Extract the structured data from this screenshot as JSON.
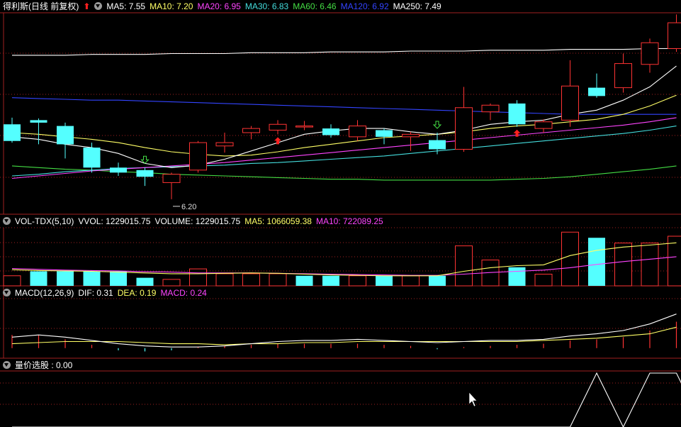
{
  "header_main": {
    "name": "得利斯(日线 前复权)",
    "ma": [
      {
        "label": "MA5: 7.55",
        "color": "#ffffff"
      },
      {
        "label": "MA10: 7.20",
        "color": "#ffff66"
      },
      {
        "label": "MA20: 6.95",
        "color": "#ff44ff"
      },
      {
        "label": "MA30: 6.83",
        "color": "#44dddd"
      },
      {
        "label": "MA60: 6.46",
        "color": "#44dd44"
      },
      {
        "label": "MA120: 6.92",
        "color": "#3344ff"
      },
      {
        "label": "MA250: 7.49",
        "color": "#ffffff"
      }
    ]
  },
  "header_vol": {
    "name": "VOL-TDX(5,10)",
    "items": [
      {
        "label": "VVOL: 1229015.75",
        "color": "#ffffff"
      },
      {
        "label": "VOLUME: 1229015.75",
        "color": "#ffffff"
      },
      {
        "label": "MA5: 1066059.38",
        "color": "#ffff66"
      },
      {
        "label": "MA10: 722089.25",
        "color": "#ff44ff"
      }
    ]
  },
  "header_macd": {
    "name": "MACD(12,26,9)",
    "items": [
      {
        "label": "DIF: 0.31",
        "color": "#ffffff"
      },
      {
        "label": "DEA: 0.19",
        "color": "#ffff66"
      },
      {
        "label": "MACD: 0.24",
        "color": "#ff44ff"
      }
    ]
  },
  "header_xg": {
    "name": "量价选股 : 0.00"
  },
  "colors": {
    "up": "#ff3333",
    "down": "#54ffff",
    "frame": "#a02020",
    "grid": "#a02020",
    "ma5": "#ffffff",
    "ma10": "#ffff66",
    "ma20": "#ff44ff",
    "ma30": "#44dddd",
    "ma60": "#44dd44",
    "ma120": "#3344ff",
    "ma250": "#ffffff"
  },
  "chart_data": {
    "type": "candlestick",
    "price_range": [
      6.02,
      8.44
    ],
    "low_annotation": {
      "text": "6.20",
      "index": 6
    },
    "candles": [
      {
        "o": 7.1,
        "h": 7.18,
        "l": 6.88,
        "c": 6.9
      },
      {
        "o": 7.15,
        "h": 7.17,
        "l": 6.86,
        "c": 7.12
      },
      {
        "o": 7.08,
        "h": 7.12,
        "l": 6.69,
        "c": 6.86
      },
      {
        "o": 6.82,
        "h": 6.88,
        "l": 6.52,
        "c": 6.58
      },
      {
        "o": 6.58,
        "h": 6.64,
        "l": 6.48,
        "c": 6.52
      },
      {
        "o": 6.55,
        "h": 6.58,
        "l": 6.36,
        "c": 6.47
      },
      {
        "o": 6.4,
        "h": 6.52,
        "l": 6.2,
        "c": 6.5
      },
      {
        "o": 6.55,
        "h": 6.9,
        "l": 6.52,
        "c": 6.88
      },
      {
        "o": 6.84,
        "h": 7.0,
        "l": 6.76,
        "c": 6.88
      },
      {
        "o": 7.0,
        "h": 7.08,
        "l": 6.92,
        "c": 7.05
      },
      {
        "o": 7.03,
        "h": 7.15,
        "l": 6.98,
        "c": 7.1
      },
      {
        "o": 7.08,
        "h": 7.14,
        "l": 7.03,
        "c": 7.08
      },
      {
        "o": 7.05,
        "h": 7.1,
        "l": 6.94,
        "c": 6.97
      },
      {
        "o": 6.95,
        "h": 7.15,
        "l": 6.9,
        "c": 7.08
      },
      {
        "o": 7.03,
        "h": 7.05,
        "l": 6.86,
        "c": 6.95
      },
      {
        "o": 6.95,
        "h": 7.01,
        "l": 6.78,
        "c": 6.98
      },
      {
        "o": 6.91,
        "h": 7.0,
        "l": 6.74,
        "c": 6.8
      },
      {
        "o": 6.8,
        "h": 7.55,
        "l": 6.77,
        "c": 7.3
      },
      {
        "o": 7.25,
        "h": 7.35,
        "l": 7.15,
        "c": 7.33
      },
      {
        "o": 7.35,
        "h": 7.39,
        "l": 7.07,
        "c": 7.1
      },
      {
        "o": 7.05,
        "h": 7.16,
        "l": 7.0,
        "c": 7.13
      },
      {
        "o": 7.15,
        "h": 7.87,
        "l": 7.07,
        "c": 7.56
      },
      {
        "o": 7.54,
        "h": 7.71,
        "l": 7.42,
        "c": 7.44
      },
      {
        "o": 7.54,
        "h": 7.95,
        "l": 7.48,
        "c": 7.83
      },
      {
        "o": 7.82,
        "h": 8.13,
        "l": 7.72,
        "c": 8.08
      },
      {
        "o": 8.01,
        "h": 8.42,
        "l": 7.97,
        "c": 8.32
      }
    ],
    "signals_up": [
      10,
      19
    ],
    "signals_hollow_down": [
      5,
      16
    ],
    "ma5": [
      6.95,
      6.92,
      6.86,
      6.82,
      6.75,
      6.63,
      6.58,
      6.61,
      6.68,
      6.78,
      6.88,
      6.98,
      7.02,
      7.05,
      7.05,
      7.01,
      6.98,
      7.03,
      7.1,
      7.13,
      7.15,
      7.22,
      7.27,
      7.39,
      7.55,
      7.8
    ],
    "ma10": [
      7.0,
      6.98,
      6.95,
      6.92,
      6.88,
      6.82,
      6.77,
      6.74,
      6.72,
      6.73,
      6.77,
      6.82,
      6.86,
      6.9,
      6.94,
      6.96,
      6.98,
      7.01,
      7.05,
      7.08,
      7.1,
      7.13,
      7.16,
      7.22,
      7.32,
      7.45
    ],
    "ma20": [
      6.45,
      6.48,
      6.51,
      6.54,
      6.56,
      6.58,
      6.6,
      6.62,
      6.64,
      6.67,
      6.7,
      6.73,
      6.76,
      6.79,
      6.82,
      6.85,
      6.88,
      6.91,
      6.94,
      6.97,
      7.0,
      7.03,
      7.06,
      7.09,
      7.13,
      7.18
    ],
    "ma30": [
      6.48,
      6.5,
      6.53,
      6.55,
      6.57,
      6.58,
      6.59,
      6.6,
      6.61,
      6.63,
      6.64,
      6.66,
      6.68,
      6.7,
      6.72,
      6.75,
      6.78,
      6.81,
      6.84,
      6.87,
      6.9,
      6.93,
      6.96,
      6.99,
      7.03,
      7.08
    ],
    "ma60": [
      6.6,
      6.58,
      6.56,
      6.55,
      6.53,
      6.52,
      6.5,
      6.49,
      6.48,
      6.47,
      6.46,
      6.45,
      6.44,
      6.44,
      6.43,
      6.43,
      6.43,
      6.43,
      6.43,
      6.44,
      6.45,
      6.47,
      6.5,
      6.53,
      6.56,
      6.6
    ],
    "ma120": [
      7.42,
      7.41,
      7.4,
      7.39,
      7.39,
      7.38,
      7.37,
      7.36,
      7.35,
      7.34,
      7.33,
      7.32,
      7.31,
      7.3,
      7.29,
      7.28,
      7.27,
      7.26,
      7.25,
      7.24,
      7.23,
      7.22,
      7.22,
      7.22,
      7.22,
      7.22
    ],
    "ma250": [
      7.93,
      7.93,
      7.93,
      7.94,
      7.94,
      7.94,
      7.95,
      7.95,
      7.95,
      7.96,
      7.96,
      7.96,
      7.97,
      7.97,
      7.97,
      7.98,
      7.98,
      7.98,
      7.99,
      7.99,
      7.99,
      8.0,
      8.0,
      8.0,
      8.01,
      8.01
    ],
    "volume": {
      "range": [
        0,
        1440000
      ],
      "values": [
        250000,
        360000,
        360000,
        360000,
        360000,
        200000,
        160000,
        420000,
        300000,
        300000,
        300000,
        250000,
        250000,
        250000,
        250000,
        250000,
        250000,
        990000,
        640000,
        460000,
        290000,
        1330000,
        1190000,
        1060000,
        1060000,
        1229015.75
      ],
      "up": [
        true,
        false,
        false,
        false,
        false,
        false,
        true,
        true,
        true,
        true,
        true,
        false,
        false,
        true,
        false,
        true,
        false,
        true,
        true,
        false,
        true,
        true,
        false,
        true,
        true,
        true
      ],
      "ma5": [
        400000,
        380000,
        370000,
        360000,
        340000,
        320000,
        300000,
        300000,
        310000,
        320000,
        310000,
        290000,
        270000,
        260000,
        250000,
        250000,
        250000,
        360000,
        450000,
        500000,
        520000,
        750000,
        880000,
        960000,
        1010000,
        1066059.38
      ],
      "ma10": [
        430000,
        410000,
        390000,
        380000,
        370000,
        350000,
        340000,
        320000,
        320000,
        320000,
        310000,
        300000,
        290000,
        280000,
        270000,
        260000,
        260000,
        290000,
        330000,
        360000,
        390000,
        450000,
        530000,
        600000,
        660000,
        722089.25
      ]
    },
    "macd": {
      "range": [
        -0.04,
        0.45
      ],
      "dif": [
        0.1,
        0.12,
        0.1,
        0.07,
        0.04,
        0.02,
        0.01,
        0.01,
        0.02,
        0.04,
        0.06,
        0.07,
        0.07,
        0.08,
        0.07,
        0.06,
        0.05,
        0.06,
        0.07,
        0.07,
        0.08,
        0.11,
        0.13,
        0.16,
        0.22,
        0.31
      ],
      "dea": [
        0.04,
        0.05,
        0.06,
        0.06,
        0.06,
        0.05,
        0.04,
        0.04,
        0.03,
        0.04,
        0.04,
        0.05,
        0.05,
        0.06,
        0.06,
        0.06,
        0.06,
        0.06,
        0.06,
        0.06,
        0.07,
        0.08,
        0.09,
        0.11,
        0.13,
        0.19
      ],
      "bar": [
        0.12,
        0.12,
        0.08,
        0.03,
        -0.02,
        -0.03,
        -0.02,
        0.01,
        0.02,
        0.03,
        0.04,
        0.04,
        0.04,
        0.04,
        0.03,
        0.02,
        -0.01,
        0.01,
        0.02,
        0.03,
        0.04,
        0.07,
        0.08,
        0.1,
        0.16,
        0.24
      ]
    },
    "xg": {
      "range": [
        0,
        1
      ],
      "values": [
        0,
        0,
        0,
        0,
        0,
        0,
        0,
        0,
        0,
        0,
        0,
        0,
        0,
        0,
        0,
        0,
        0,
        0,
        0,
        0,
        0,
        0,
        1,
        0,
        1,
        1,
        0
      ]
    }
  }
}
